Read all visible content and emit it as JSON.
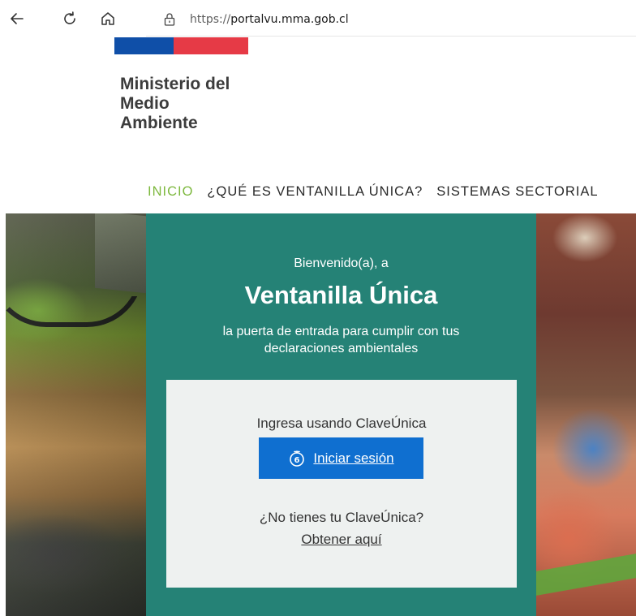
{
  "browser": {
    "url_scheme": "https://",
    "url_host": "portalvu.mma.gob.cl"
  },
  "logo": {
    "lines": [
      "Ministerio del",
      "Medio",
      "Ambiente"
    ],
    "stripe_colors": [
      "#0f4fa8",
      "#e63a46"
    ]
  },
  "nav": {
    "items": [
      {
        "label": "INICIO",
        "active": true
      },
      {
        "label": "¿QUÉ ES VENTANILLA ÚNICA?",
        "active": false
      },
      {
        "label": "SISTEMAS SECTORIAL",
        "active": false
      }
    ],
    "active_color": "#7db83e"
  },
  "hero": {
    "greeting": "Bienvenido(a), a",
    "title": "Ventanilla Única",
    "subtitle_lines": [
      "la puerta de entrada para cumplir con tus",
      "declaraciones ambientales"
    ],
    "panel_color": "#14786c"
  },
  "login": {
    "prompt": "Ingresa usando ClaveÚnica",
    "button_label": "Iniciar sesión",
    "button_color": "#0f6fd0",
    "no_clave": "¿No tienes tu ClaveÚnica?",
    "obtain_link": "Obtener aquí"
  },
  "icons": {
    "back": "arrow-left-icon",
    "refresh": "refresh-icon",
    "home": "home-icon",
    "lock": "lock-icon",
    "clave": "claveunica-icon"
  }
}
